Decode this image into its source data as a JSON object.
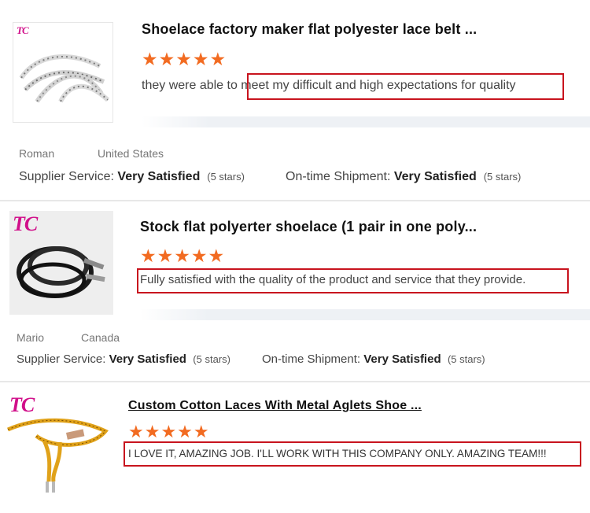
{
  "reviews": [
    {
      "title": "Shoelace factory maker flat polyester lace belt ...",
      "stars": "★★★★★",
      "rating": 5,
      "review_prefix": "they were able to ",
      "review_highlight": "meet my difficult and high expectations for quality",
      "brand_mark": "TC",
      "reviewer_name": "Roman",
      "reviewer_country": "United States",
      "supplier_label": "Supplier Service:",
      "supplier_value": "Very Satisfied",
      "supplier_stars": "(5 stars)",
      "shipment_label": "On-time Shipment:",
      "shipment_value": "Very Satisfied",
      "shipment_stars": "(5 stars)"
    },
    {
      "title": "Stock flat polyerter shoelace (1 pair in one poly...",
      "stars": "★★★★★",
      "rating": 5,
      "review_highlight": "Fully satisfied with the quality of the product and service that they provide.",
      "brand_mark": "TC",
      "reviewer_name": "Mario",
      "reviewer_country": "Canada",
      "supplier_label": "Supplier Service:",
      "supplier_value": "Very Satisfied",
      "supplier_stars": "(5 stars)",
      "shipment_label": "On-time Shipment:",
      "shipment_value": "Very Satisfied",
      "shipment_stars": "(5 stars)"
    },
    {
      "title": "Custom Cotton Laces With Metal Aglets Shoe ...",
      "stars": "★★★★★",
      "rating": 5,
      "review_highlight": "I LOVE IT, AMAZING JOB. I'LL WORK WITH THIS COMPANY ONLY. AMAZING TEAM!!!",
      "brand_mark": "TC"
    }
  ],
  "colors": {
    "star": "#f26b21",
    "highlight_box": "#c8141e",
    "brand": "#d10f8a"
  }
}
